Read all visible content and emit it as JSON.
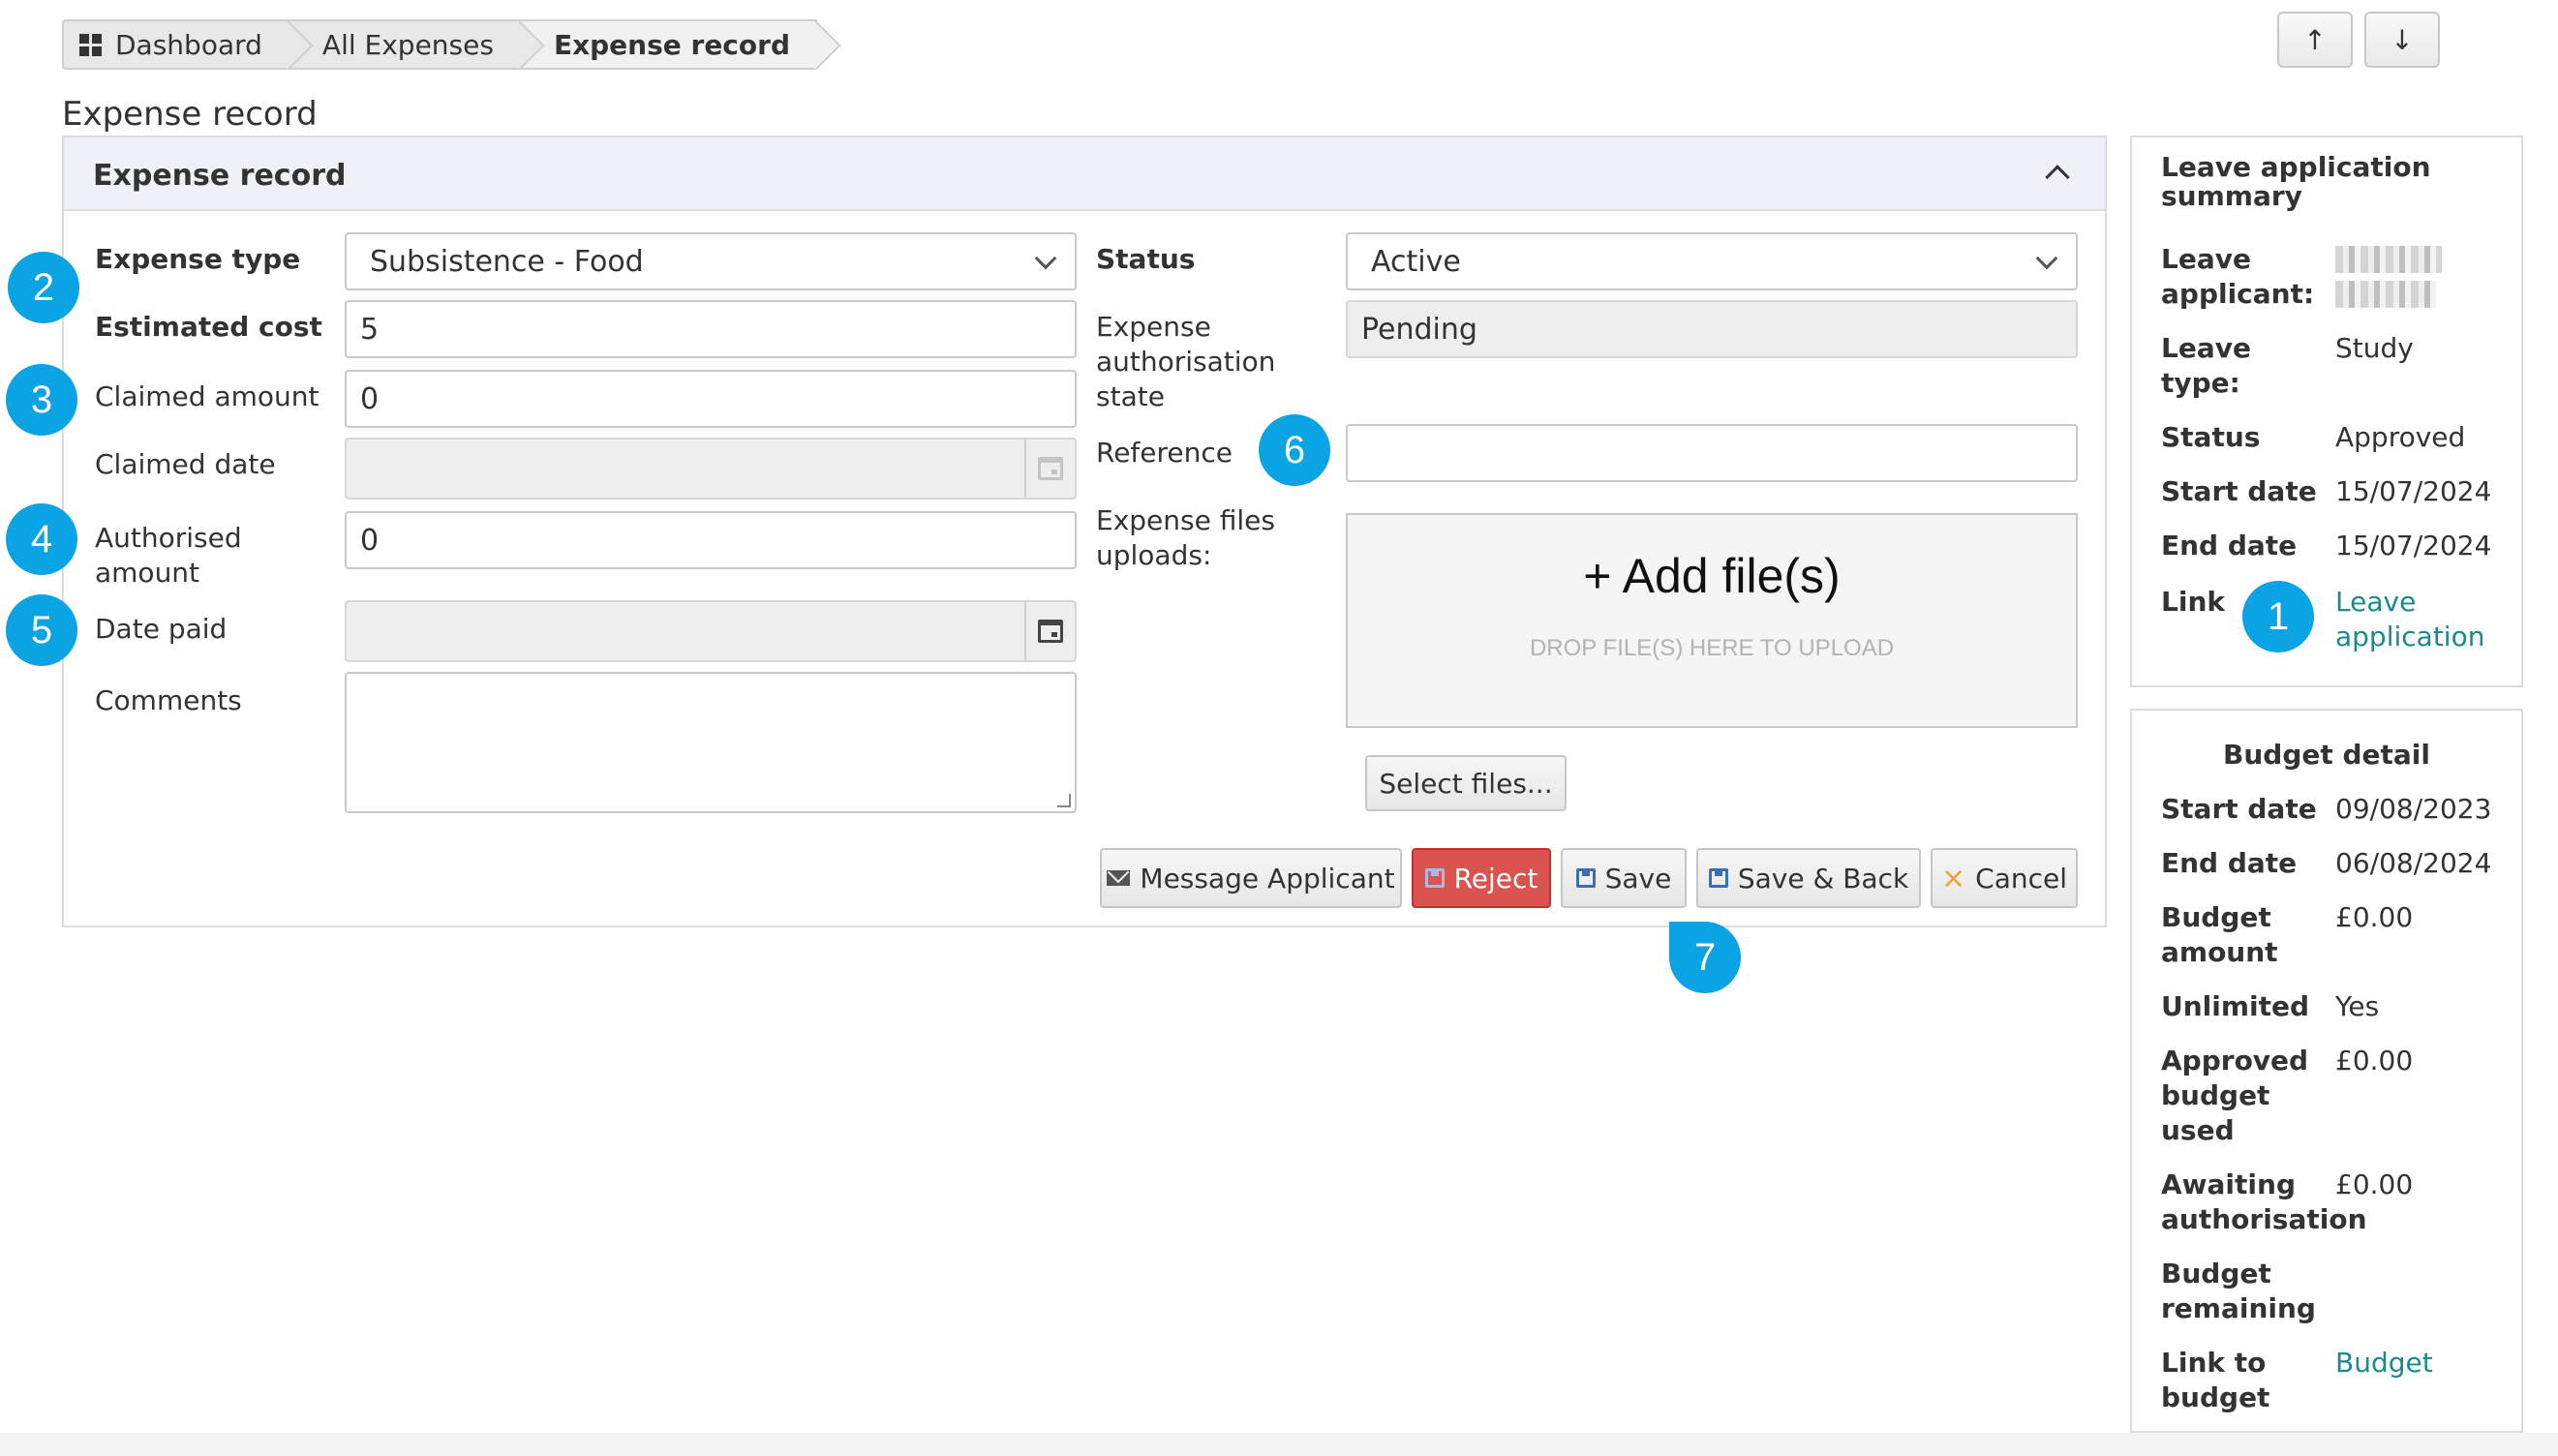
{
  "breadcrumb": {
    "items": [
      "Dashboard",
      "All Expenses",
      "Expense record"
    ]
  },
  "nav": {
    "up_label": "↑",
    "down_label": "↓"
  },
  "page_heading": "Expense record",
  "panel": {
    "title": "Expense record",
    "fields": {
      "expense_type_label": "Expense type",
      "expense_type_value": "Subsistence - Food",
      "estimated_cost_label": "Estimated cost",
      "estimated_cost_value": "5",
      "claimed_amount_label": "Claimed amount",
      "claimed_amount_value": "0",
      "claimed_date_label": "Claimed date",
      "authorised_amount_label": "Authorised amount",
      "authorised_amount_value": "0",
      "date_paid_label": "Date paid",
      "comments_label": "Comments",
      "status_label": "Status",
      "status_value": "Active",
      "auth_state_label": "Expense authorisation state",
      "auth_state_value": "Pending",
      "reference_label": "Reference",
      "uploads_label": "Expense files uploads:"
    },
    "dropzone": {
      "title": "+ Add file(s)",
      "subtitle": "DROP FILE(S) HERE TO UPLOAD"
    },
    "select_files_label": "Select files...",
    "buttons": {
      "message_applicant": "Message Applicant",
      "reject": "Reject",
      "save": "Save",
      "save_back": "Save & Back",
      "cancel": "Cancel"
    }
  },
  "leave_summary": {
    "title": "Leave application summary",
    "rows": {
      "applicant_label": "Leave applicant:",
      "type_label": "Leave type:",
      "type_value": "Study",
      "status_label": "Status",
      "status_value": "Approved",
      "start_label": "Start date",
      "start_value": "15/07/2024",
      "end_label": "End date",
      "end_value": "15/07/2024",
      "link_label": "Link",
      "link_value": "Leave application"
    }
  },
  "budget_detail": {
    "title": "Budget detail",
    "rows": {
      "start_label": "Start date",
      "start_value": "09/08/2023",
      "end_label": "End date",
      "end_value": "06/08/2024",
      "amount_label": "Budget amount",
      "amount_value": "£0.00",
      "unlimited_label": "Unlimited",
      "unlimited_value": "Yes",
      "approved_used_label": "Approved budget used",
      "approved_used_value": "£0.00",
      "awaiting_label": "Awaiting authorisation",
      "awaiting_value": "£0.00",
      "remaining_label": "Budget remaining",
      "link_label": "Link to budget",
      "link_value": "Budget"
    }
  },
  "callouts": [
    "1",
    "2",
    "3",
    "4",
    "5",
    "6",
    "7"
  ],
  "colors": {
    "callout": "#0aa3e3",
    "reject": "#d9534f",
    "link": "#1a8a8a",
    "panel_header": "#eef1f7"
  }
}
